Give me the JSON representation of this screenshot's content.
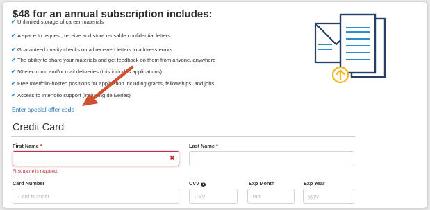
{
  "promo": {
    "heading": "$48 for an annual subscription includes:",
    "features": [
      "Unlimited storage of career materials",
      "A space to request, receive and store reusable confidential letters",
      "Guaranteed quality checks on all received letters to address errors",
      "The ability to share your materials and get feedback on them from anyone, anywhere",
      "50 electronic and/or mail deliveries (this includes applications)",
      "Free Interfolio-hosted positions for application including grants, fellowships, and jobs",
      "Access to Interfolio support (including deliveries)"
    ],
    "check_glyph": "✔",
    "offer_link": "Enter special offer code"
  },
  "credit_card": {
    "title": "Credit Card",
    "first_name": {
      "label": "First Name",
      "required_mark": "*",
      "value": "",
      "error": "First name is required."
    },
    "last_name": {
      "label": "Last Name",
      "required_mark": "*",
      "value": ""
    },
    "card_number": {
      "label": "Card Number",
      "placeholder": "Card Number"
    },
    "cvv": {
      "label": "CVV",
      "help_glyph": "?",
      "placeholder": "CVV"
    },
    "exp_month": {
      "label": "Exp Month",
      "placeholder": "mm"
    },
    "exp_year": {
      "label": "Exp Year",
      "placeholder": "yyyy"
    }
  },
  "colors": {
    "accent": "#2b8ed1",
    "link": "#2577b8",
    "error": "#c0262d",
    "illustration_navy": "#263f63",
    "illustration_yellow": "#f3b51b",
    "annotation_arrow": "#d1502f"
  },
  "icons": {
    "check": "checkmark-icon",
    "clear": "close-icon",
    "help": "question-circle-icon",
    "illustration": "documents-upload-illustration",
    "annotation": "annotation-arrow"
  }
}
